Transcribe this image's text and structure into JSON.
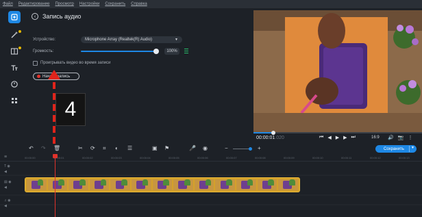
{
  "menu": [
    "Файл",
    "Редактирование",
    "Просмотр",
    "Настройки",
    "Сохранить",
    "Справка"
  ],
  "tools": [
    {
      "name": "import-icon",
      "active": true
    },
    {
      "name": "magic-wand-icon",
      "active": false
    },
    {
      "name": "transitions-icon",
      "active": false
    },
    {
      "name": "titles-icon",
      "active": false
    },
    {
      "name": "stickers-icon",
      "active": false
    },
    {
      "name": "more-tools-icon",
      "active": false
    }
  ],
  "panel": {
    "title": "Запись аудио",
    "device_label": "Устройство:",
    "device_value": "Microphone Array (Realtek(R) Audio)",
    "volume_label": "Громкость:",
    "volume_percent": "100%",
    "volume_level": 1.0,
    "play_video_label": "Проигрывать видео во время записи",
    "play_video_checked": false,
    "record_button": "Начать запись"
  },
  "annotation": {
    "step_number": "4"
  },
  "player": {
    "timecode": "00:00:01",
    "timecode_frames": ".020",
    "aspect": "16:9",
    "progress": 0.11
  },
  "timeline": {
    "save_label": "Сохранить",
    "ruler_ticks": [
      "00:00:00",
      "00:00:01",
      "00:00:02",
      "00:00:03",
      "00:00:04",
      "00:00:05",
      "00:00:06",
      "00:00:07",
      "00:00:08",
      "00:00:09",
      "00:00:10",
      "00:00:11",
      "00:00:12",
      "00:00:13"
    ],
    "clip_thumbnail_count": 13
  },
  "colors": {
    "accent": "#1e88e5",
    "record": "#e0322b",
    "clip": "#d4a12a",
    "background": "#1d2127"
  }
}
